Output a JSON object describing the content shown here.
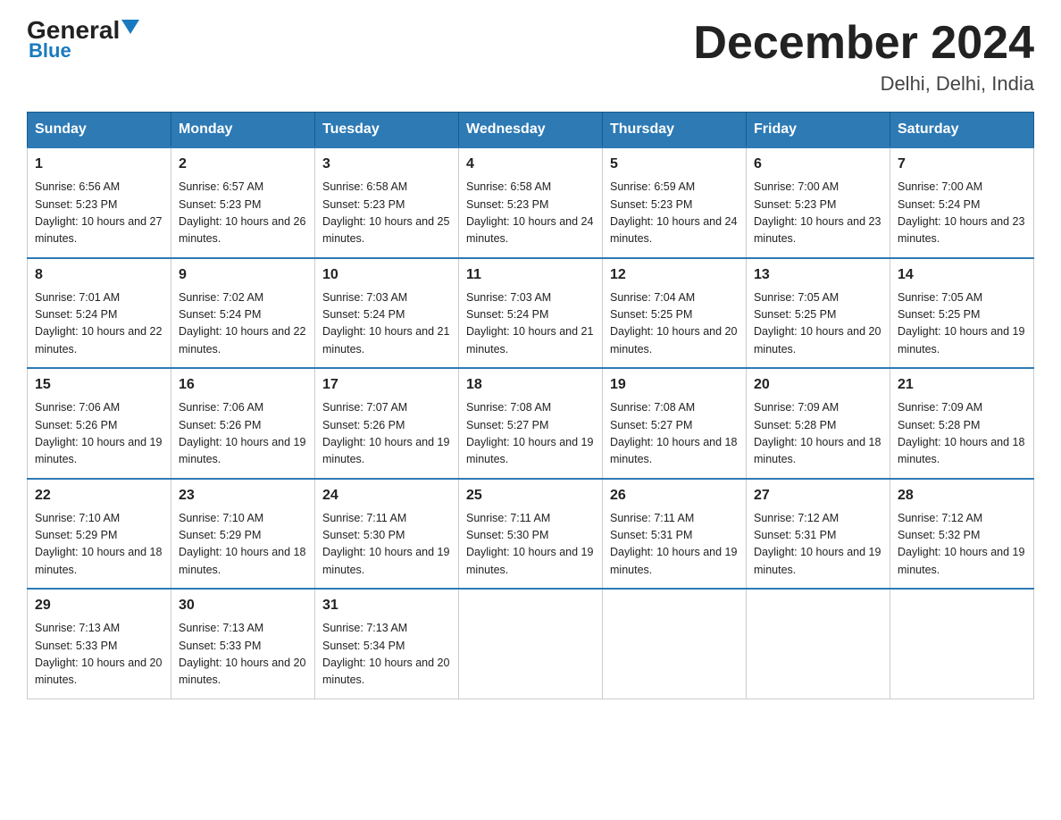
{
  "header": {
    "logo_general": "General",
    "logo_blue": "Blue",
    "title": "December 2024",
    "subtitle": "Delhi, Delhi, India"
  },
  "weekdays": [
    "Sunday",
    "Monday",
    "Tuesday",
    "Wednesday",
    "Thursday",
    "Friday",
    "Saturday"
  ],
  "weeks": [
    [
      {
        "day": "1",
        "sunrise": "6:56 AM",
        "sunset": "5:23 PM",
        "daylight": "10 hours and 27 minutes."
      },
      {
        "day": "2",
        "sunrise": "6:57 AM",
        "sunset": "5:23 PM",
        "daylight": "10 hours and 26 minutes."
      },
      {
        "day": "3",
        "sunrise": "6:58 AM",
        "sunset": "5:23 PM",
        "daylight": "10 hours and 25 minutes."
      },
      {
        "day": "4",
        "sunrise": "6:58 AM",
        "sunset": "5:23 PM",
        "daylight": "10 hours and 24 minutes."
      },
      {
        "day": "5",
        "sunrise": "6:59 AM",
        "sunset": "5:23 PM",
        "daylight": "10 hours and 24 minutes."
      },
      {
        "day": "6",
        "sunrise": "7:00 AM",
        "sunset": "5:23 PM",
        "daylight": "10 hours and 23 minutes."
      },
      {
        "day": "7",
        "sunrise": "7:00 AM",
        "sunset": "5:24 PM",
        "daylight": "10 hours and 23 minutes."
      }
    ],
    [
      {
        "day": "8",
        "sunrise": "7:01 AM",
        "sunset": "5:24 PM",
        "daylight": "10 hours and 22 minutes."
      },
      {
        "day": "9",
        "sunrise": "7:02 AM",
        "sunset": "5:24 PM",
        "daylight": "10 hours and 22 minutes."
      },
      {
        "day": "10",
        "sunrise": "7:03 AM",
        "sunset": "5:24 PM",
        "daylight": "10 hours and 21 minutes."
      },
      {
        "day": "11",
        "sunrise": "7:03 AM",
        "sunset": "5:24 PM",
        "daylight": "10 hours and 21 minutes."
      },
      {
        "day": "12",
        "sunrise": "7:04 AM",
        "sunset": "5:25 PM",
        "daylight": "10 hours and 20 minutes."
      },
      {
        "day": "13",
        "sunrise": "7:05 AM",
        "sunset": "5:25 PM",
        "daylight": "10 hours and 20 minutes."
      },
      {
        "day": "14",
        "sunrise": "7:05 AM",
        "sunset": "5:25 PM",
        "daylight": "10 hours and 19 minutes."
      }
    ],
    [
      {
        "day": "15",
        "sunrise": "7:06 AM",
        "sunset": "5:26 PM",
        "daylight": "10 hours and 19 minutes."
      },
      {
        "day": "16",
        "sunrise": "7:06 AM",
        "sunset": "5:26 PM",
        "daylight": "10 hours and 19 minutes."
      },
      {
        "day": "17",
        "sunrise": "7:07 AM",
        "sunset": "5:26 PM",
        "daylight": "10 hours and 19 minutes."
      },
      {
        "day": "18",
        "sunrise": "7:08 AM",
        "sunset": "5:27 PM",
        "daylight": "10 hours and 19 minutes."
      },
      {
        "day": "19",
        "sunrise": "7:08 AM",
        "sunset": "5:27 PM",
        "daylight": "10 hours and 18 minutes."
      },
      {
        "day": "20",
        "sunrise": "7:09 AM",
        "sunset": "5:28 PM",
        "daylight": "10 hours and 18 minutes."
      },
      {
        "day": "21",
        "sunrise": "7:09 AM",
        "sunset": "5:28 PM",
        "daylight": "10 hours and 18 minutes."
      }
    ],
    [
      {
        "day": "22",
        "sunrise": "7:10 AM",
        "sunset": "5:29 PM",
        "daylight": "10 hours and 18 minutes."
      },
      {
        "day": "23",
        "sunrise": "7:10 AM",
        "sunset": "5:29 PM",
        "daylight": "10 hours and 18 minutes."
      },
      {
        "day": "24",
        "sunrise": "7:11 AM",
        "sunset": "5:30 PM",
        "daylight": "10 hours and 19 minutes."
      },
      {
        "day": "25",
        "sunrise": "7:11 AM",
        "sunset": "5:30 PM",
        "daylight": "10 hours and 19 minutes."
      },
      {
        "day": "26",
        "sunrise": "7:11 AM",
        "sunset": "5:31 PM",
        "daylight": "10 hours and 19 minutes."
      },
      {
        "day": "27",
        "sunrise": "7:12 AM",
        "sunset": "5:31 PM",
        "daylight": "10 hours and 19 minutes."
      },
      {
        "day": "28",
        "sunrise": "7:12 AM",
        "sunset": "5:32 PM",
        "daylight": "10 hours and 19 minutes."
      }
    ],
    [
      {
        "day": "29",
        "sunrise": "7:13 AM",
        "sunset": "5:33 PM",
        "daylight": "10 hours and 20 minutes."
      },
      {
        "day": "30",
        "sunrise": "7:13 AM",
        "sunset": "5:33 PM",
        "daylight": "10 hours and 20 minutes."
      },
      {
        "day": "31",
        "sunrise": "7:13 AM",
        "sunset": "5:34 PM",
        "daylight": "10 hours and 20 minutes."
      },
      null,
      null,
      null,
      null
    ]
  ]
}
